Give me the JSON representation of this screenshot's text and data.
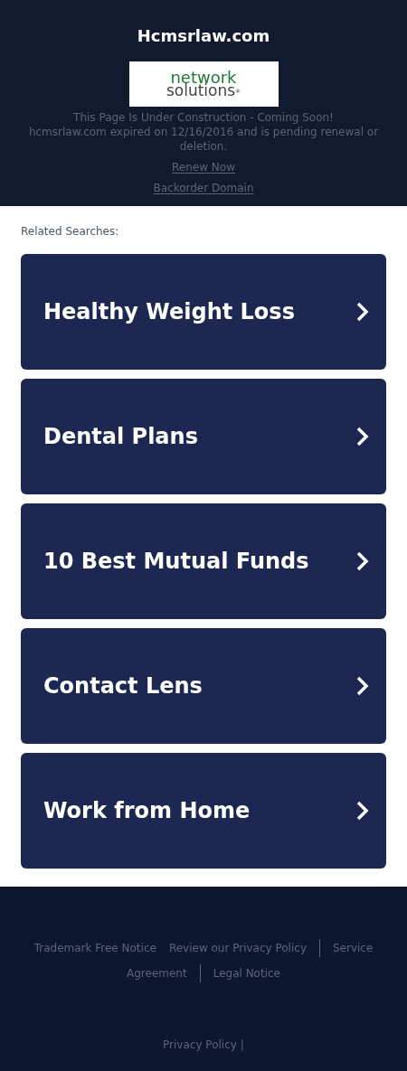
{
  "header": {
    "title": "Hcmsrlaw.com",
    "logo": {
      "line_1": "network",
      "line_2": "solutions",
      "mark": "®"
    },
    "notice": "This Page Is Under Construction - Coming Soon!",
    "expiry": "hcmsrlaw.com expired on 12/16/2016 and is pending renewal or deletion.",
    "links": [
      "Renew Now",
      "Backorder Domain"
    ]
  },
  "related": {
    "heading": "Related Searches:",
    "items": [
      {
        "label": "Healthy Weight Loss"
      },
      {
        "label": "Dental Plans"
      },
      {
        "label": "10 Best Mutual Funds"
      },
      {
        "label": "Contact Lens"
      },
      {
        "label": "Work from Home"
      }
    ]
  },
  "footer": {
    "rows": [
      [
        {
          "kind": "link",
          "label": "Trademark Free Notice"
        },
        {
          "kind": "link",
          "label": "Review our Privacy Policy"
        },
        {
          "kind": "divider"
        },
        {
          "kind": "link",
          "label": "Service"
        }
      ],
      [
        {
          "kind": "link",
          "label": "Agreement"
        },
        {
          "kind": "divider"
        },
        {
          "kind": "link",
          "label": "Legal Notice"
        }
      ]
    ],
    "privacy": "Privacy Policy",
    "separator": "|"
  }
}
